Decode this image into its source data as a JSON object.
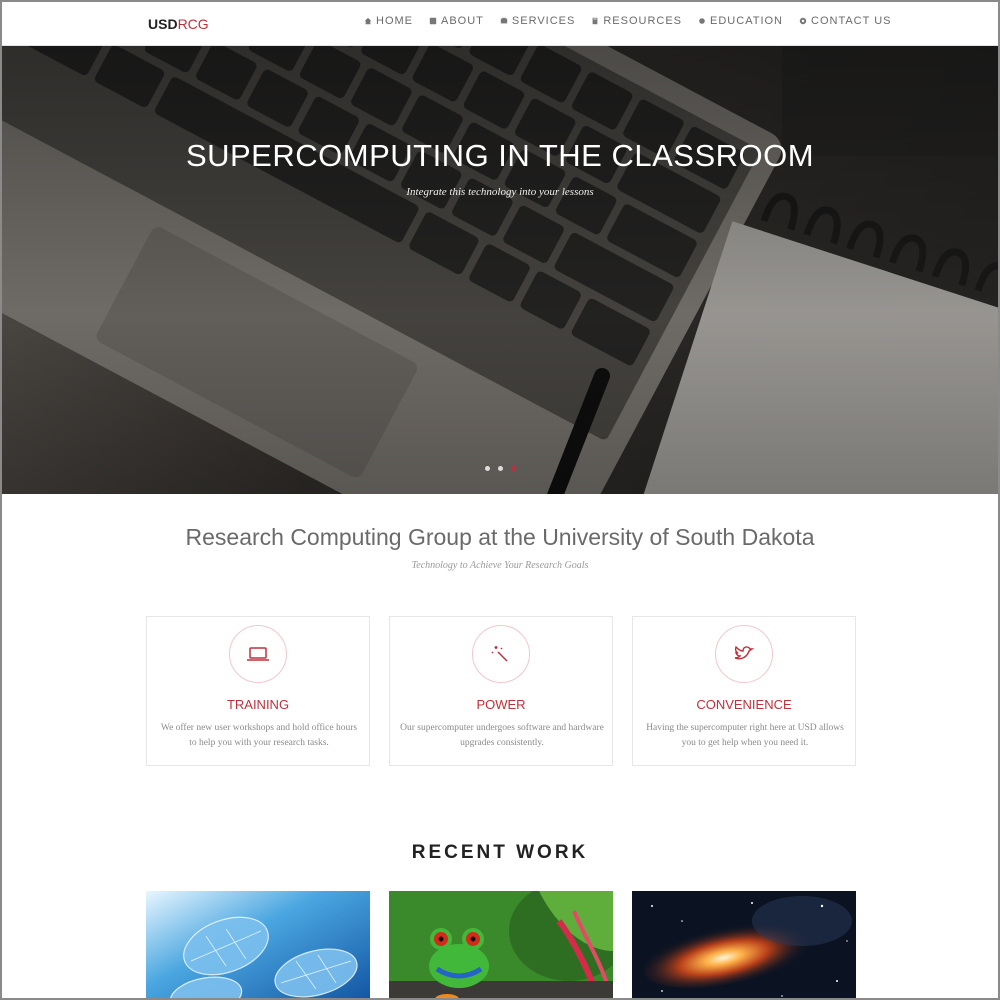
{
  "brand": {
    "part1": "USD",
    "part2": "RCG"
  },
  "nav": [
    {
      "label": "HOME",
      "icon": "home-icon"
    },
    {
      "label": "ABOUT",
      "icon": "info-icon"
    },
    {
      "label": "SERVICES",
      "icon": "services-icon"
    },
    {
      "label": "RESOURCES",
      "icon": "book-icon"
    },
    {
      "label": "EDUCATION",
      "icon": "star-icon"
    },
    {
      "label": "CONTACT US",
      "icon": "contact-icon"
    }
  ],
  "hero": {
    "title": "SUPERCOMPUTING IN THE CLASSROOM",
    "subtitle": "Integrate this technology into your lessons",
    "slides": 3,
    "active_slide": 3
  },
  "intro": {
    "title": "Research Computing Group at the University of South Dakota",
    "subtitle": "Technology to Achieve Your Research Goals"
  },
  "features": [
    {
      "title": "TRAINING",
      "icon": "laptop-icon",
      "text": "We offer new user workshops and hold office hours to help you with your research tasks."
    },
    {
      "title": "POWER",
      "icon": "magic-wand-icon",
      "text": "Our supercomputer undergoes software and hardware upgrades consistently."
    },
    {
      "title": "CONVENIENCE",
      "icon": "twitter-bird-icon",
      "text": "Having the supercomputer right here at USD allows you to get help when you need it."
    }
  ],
  "recent": {
    "title": "RECENT WORK"
  },
  "colors": {
    "accent": "#c0303a",
    "text": "#6a6a6a",
    "hero_bg": "#2a2826"
  }
}
